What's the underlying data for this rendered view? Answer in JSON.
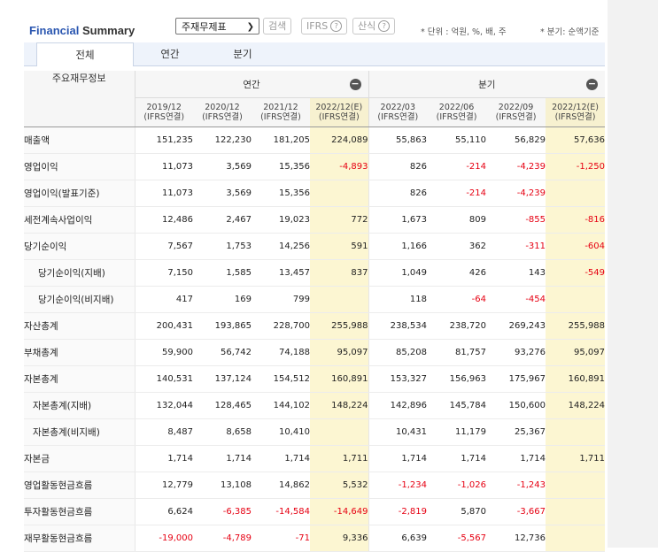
{
  "header": {
    "title_brand": "Financial",
    "title_rest": " Summary",
    "select_value": "주재무제표",
    "search_label": "검색",
    "ifrs_label": "IFRS",
    "formula_label": "산식",
    "help_glyph": "?",
    "unit_note": "* 단위 : 억원, %, 배, 주",
    "quarter_note": "* 분기: 순액기준"
  },
  "tabs": [
    "전체",
    "연간",
    "분기"
  ],
  "table": {
    "corner_label": "주요재무정보",
    "annual_label": "연간",
    "quarter_label": "분기",
    "collapse_glyph": "−",
    "periods": [
      {
        "date": "2019/12",
        "basis": "(IFRS연결)"
      },
      {
        "date": "2020/12",
        "basis": "(IFRS연결)"
      },
      {
        "date": "2021/12",
        "basis": "(IFRS연결)"
      },
      {
        "date": "2022/12(E)",
        "basis": "(IFRS연결)"
      },
      {
        "date": "2022/03",
        "basis": "(IFRS연결)"
      },
      {
        "date": "2022/06",
        "basis": "(IFRS연결)"
      },
      {
        "date": "2022/09",
        "basis": "(IFRS연결)"
      },
      {
        "date": "2022/12(E)",
        "basis": "(IFRS연결)"
      }
    ],
    "rows": [
      {
        "label": "매출액",
        "indent": 0,
        "values": [
          "151,235",
          "122,230",
          "181,205",
          "224,089",
          "55,863",
          "55,110",
          "56,829",
          "57,636"
        ]
      },
      {
        "label": "영업이익",
        "indent": 0,
        "values": [
          "11,073",
          "3,569",
          "15,356",
          "-4,893",
          "826",
          "-214",
          "-4,239",
          "-1,250"
        ]
      },
      {
        "label": "영업이익(발표기준)",
        "indent": 0,
        "values": [
          "11,073",
          "3,569",
          "15,356",
          "",
          "826",
          "-214",
          "-4,239",
          ""
        ]
      },
      {
        "label": "세전계속사업이익",
        "indent": 0,
        "values": [
          "12,486",
          "2,467",
          "19,023",
          "772",
          "1,673",
          "809",
          "-855",
          "-816"
        ]
      },
      {
        "label": "당기순이익",
        "indent": 0,
        "values": [
          "7,567",
          "1,753",
          "14,256",
          "591",
          "1,166",
          "362",
          "-311",
          "-604"
        ]
      },
      {
        "label": "당기순이익(지배)",
        "indent": 1,
        "values": [
          "7,150",
          "1,585",
          "13,457",
          "837",
          "1,049",
          "426",
          "143",
          "-549"
        ]
      },
      {
        "label": "당기순이익(비지배)",
        "indent": 1,
        "values": [
          "417",
          "169",
          "799",
          "",
          "118",
          "-64",
          "-454",
          ""
        ]
      },
      {
        "label": "자산총계",
        "indent": 0,
        "values": [
          "200,431",
          "193,865",
          "228,700",
          "255,988",
          "238,534",
          "238,720",
          "269,243",
          "255,988"
        ]
      },
      {
        "label": "부채총계",
        "indent": 0,
        "values": [
          "59,900",
          "56,742",
          "74,188",
          "95,097",
          "85,208",
          "81,757",
          "93,276",
          "95,097"
        ]
      },
      {
        "label": "자본총계",
        "indent": 0,
        "values": [
          "140,531",
          "137,124",
          "154,512",
          "160,891",
          "153,327",
          "156,963",
          "175,967",
          "160,891"
        ]
      },
      {
        "label": "자본총계(지배)",
        "indent": 2,
        "values": [
          "132,044",
          "128,465",
          "144,102",
          "148,224",
          "142,896",
          "145,784",
          "150,600",
          "148,224"
        ]
      },
      {
        "label": "자본총계(비지배)",
        "indent": 2,
        "values": [
          "8,487",
          "8,658",
          "10,410",
          "",
          "10,431",
          "11,179",
          "25,367",
          ""
        ]
      },
      {
        "label": "자본금",
        "indent": 0,
        "values": [
          "1,714",
          "1,714",
          "1,714",
          "1,711",
          "1,714",
          "1,714",
          "1,714",
          "1,711"
        ]
      },
      {
        "label": "영업활동현금흐름",
        "indent": 0,
        "values": [
          "12,779",
          "13,108",
          "14,862",
          "5,532",
          "-1,234",
          "-1,026",
          "-1,243",
          ""
        ]
      },
      {
        "label": "투자활동현금흐름",
        "indent": 0,
        "values": [
          "6,624",
          "-6,385",
          "-14,584",
          "-14,649",
          "-2,819",
          "5,870",
          "-3,667",
          ""
        ]
      },
      {
        "label": "재무활동현금흐름",
        "indent": 0,
        "values": [
          "-19,000",
          "-4,789",
          "-71",
          "9,336",
          "6,639",
          "-5,567",
          "12,736",
          ""
        ]
      }
    ]
  },
  "colors": {
    "brand_blue": "#2a56b0",
    "negative_red": "#e60012",
    "estimate_bg": "#fcf6d2",
    "tab_bg": "#eef3fb"
  }
}
